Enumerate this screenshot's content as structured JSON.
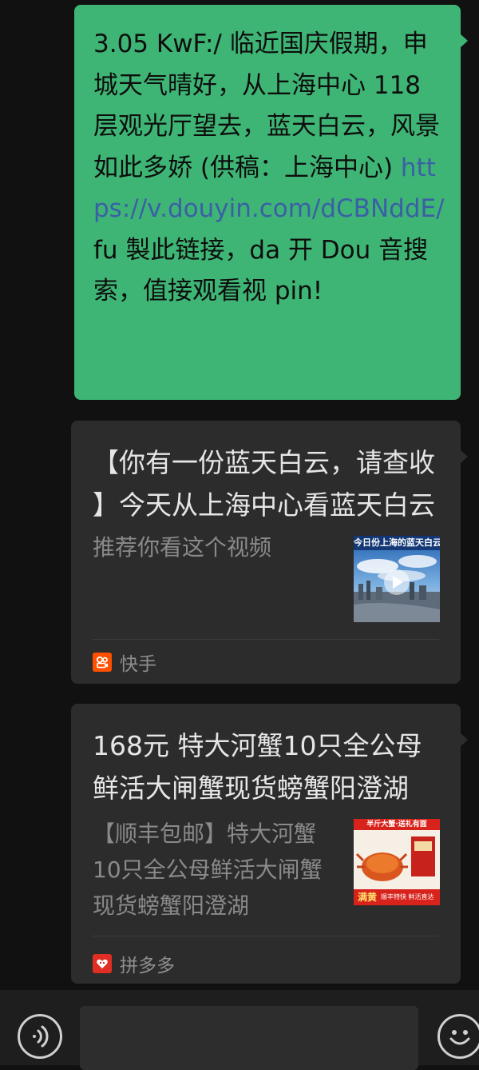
{
  "messages": {
    "outgoing": {
      "text_before": "3.05 KwF:/ 临近国庆假期，申城天气晴好，从上海中心 118 层观光厅望去，蓝天白云，风景如此多娇 (供稿：上海中心) ",
      "link": "https://v.douyin.com/dCBNddE/",
      "text_after": " fu 製此链接，da 开 Dou 音搜索，值接观看视 pin!"
    },
    "cards": [
      {
        "title": "【你有一份蓝天白云，请查收 】今天从上海中心看蓝天白云",
        "description": "推荐你看这个视频",
        "thumbnail_caption": "今日份上海的蓝天白云",
        "source": "快手",
        "source_icon": "kuaishou-icon",
        "source_color": "#ff5000"
      },
      {
        "title": "168元 特大河蟹10只全公母鲜活大闸蟹现货螃蟹阳澄湖",
        "description": "【顺丰包邮】特大河蟹10只全公母鲜活大闸蟹现货螃蟹阳澄湖",
        "thumbnail_top": "半斤大蟹·送礼有面",
        "thumbnail_badge": "满黄",
        "thumbnail_bottom": "顺丰特快 鲜活直达",
        "source": "拼多多",
        "source_icon": "pinduoduo-icon",
        "source_color": "#e02e24"
      }
    ]
  },
  "input_bar": {
    "voice_icon": "voice-icon",
    "emoji_icon": "emoji-icon"
  },
  "colors": {
    "outgoing_bubble": "#3eb575",
    "card_background": "#2c2c2c",
    "link": "#3b5fa6",
    "background": "#111111"
  }
}
